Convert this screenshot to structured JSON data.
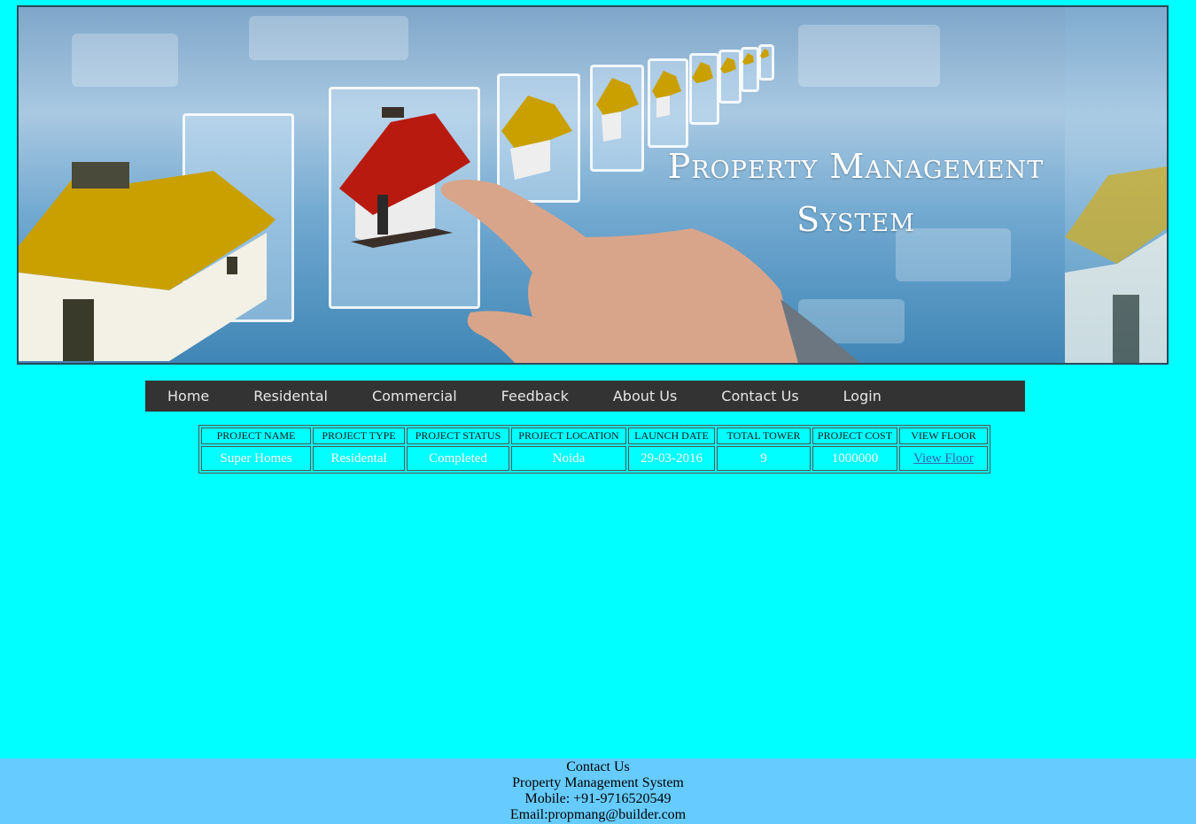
{
  "banner": {
    "title_line1": "Property Management",
    "title_line2": "System"
  },
  "nav": {
    "items": [
      "Home",
      "Residental",
      "Commercial",
      "Feedback",
      "About Us",
      "Contact Us",
      "Login"
    ]
  },
  "table": {
    "headers": [
      "PROJECT NAME",
      "PROJECT TYPE",
      "PROJECT STATUS",
      "PROJECT LOCATION",
      "LAUNCH DATE",
      "TOTAL TOWER",
      "PROJECT COST",
      "VIEW FLOOR"
    ],
    "rows": [
      [
        "Super Homes",
        "Residental",
        "Completed",
        "Noida",
        "29-03-2016",
        "9",
        "1000000",
        "View Floor"
      ]
    ]
  },
  "footer": {
    "heading": "Contact Us",
    "company": "Property Management System",
    "mobile": "Mobile: +91-9716520549",
    "email": "Email:propmang@builder.com"
  },
  "colors": {
    "page_bg": "#00ffff",
    "nav_bg": "#333333",
    "footer_bg": "#66ccff",
    "link": "#3366aa"
  }
}
